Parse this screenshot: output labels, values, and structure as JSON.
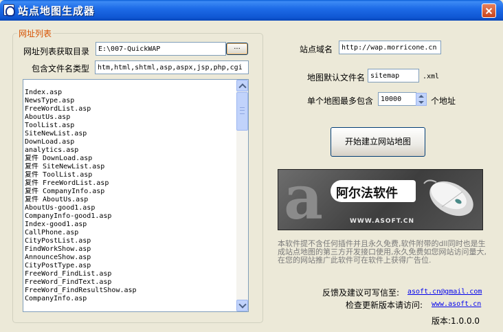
{
  "window": {
    "title": "站点地图生成器"
  },
  "group": {
    "title": "网址列表"
  },
  "left": {
    "dir_label": "网址列表获取目录",
    "dir_value": "E:\\007-QuickWAP",
    "browse_label": "...",
    "types_label": "包含文件名类型",
    "types_value": "htm,html,shtml,asp,aspx,jsp,php,cgi"
  },
  "files": [
    "Index.asp",
    "NewsType.asp",
    "FreeWordList.asp",
    "AboutUs.asp",
    "ToolList.asp",
    "SiteNewList.asp",
    "DownLoad.asp",
    "analytics.asp",
    "复件 DownLoad.asp",
    "复件 SiteNewList.asp",
    "复件 ToolList.asp",
    "复件 FreeWordList.asp",
    "复件 CompanyInfo.asp",
    "复件 AboutUs.asp",
    "AboutUs-good1.asp",
    "CompanyInfo-good1.asp",
    "Index-good1.asp",
    "CallPhone.asp",
    "CityPostList.asp",
    "FindWorkShow.asp",
    "AnnounceShow.asp",
    "CityPostType.asp",
    "FreeWord_FindList.asp",
    "FreeWord_FindText.asp",
    "FreeWord_FindResultShow.asp",
    "CompanyInfo.asp"
  ],
  "right": {
    "domain_label": "站点域名",
    "domain_value": "http://wap.morricone.cn",
    "filename_label": "地图默认文件名",
    "filename_value": "sitemap",
    "filename_ext": ".xml",
    "max_label": "单个地图最多包含",
    "max_value": "10000",
    "max_unit": "个地址",
    "start_button": "开始建立网站地图"
  },
  "banner": {
    "letter": "a",
    "title": "阿尔法软件",
    "url": "WWW.ASOFT.CN"
  },
  "description": "本软件提不含任何插件并且永久免费,软件附带的dll同时也是生成站点地图的第三方开发接口使用,永久免费如您网站访问量大,在您的网站推广此软件可在软件上获得广告位.",
  "feedback": {
    "label": "反馈及建议可写信至:",
    "email": "asoft.cn@gmail.com"
  },
  "update": {
    "label": "检查更新版本请访问:",
    "url": "www.asoft.cn"
  },
  "version": "版本:1.0.0.0",
  "colors": {
    "title_bar": "#0F56D3",
    "legend": "#D65100",
    "link": "#0000EE",
    "description": "#7A7A7A",
    "window_bg": "#ECE9D8"
  },
  "icons": [
    "app-icon",
    "close-icon",
    "scroll-up-icon",
    "scroll-down-icon",
    "spin-up-icon",
    "spin-down-icon",
    "mouse-image"
  ]
}
